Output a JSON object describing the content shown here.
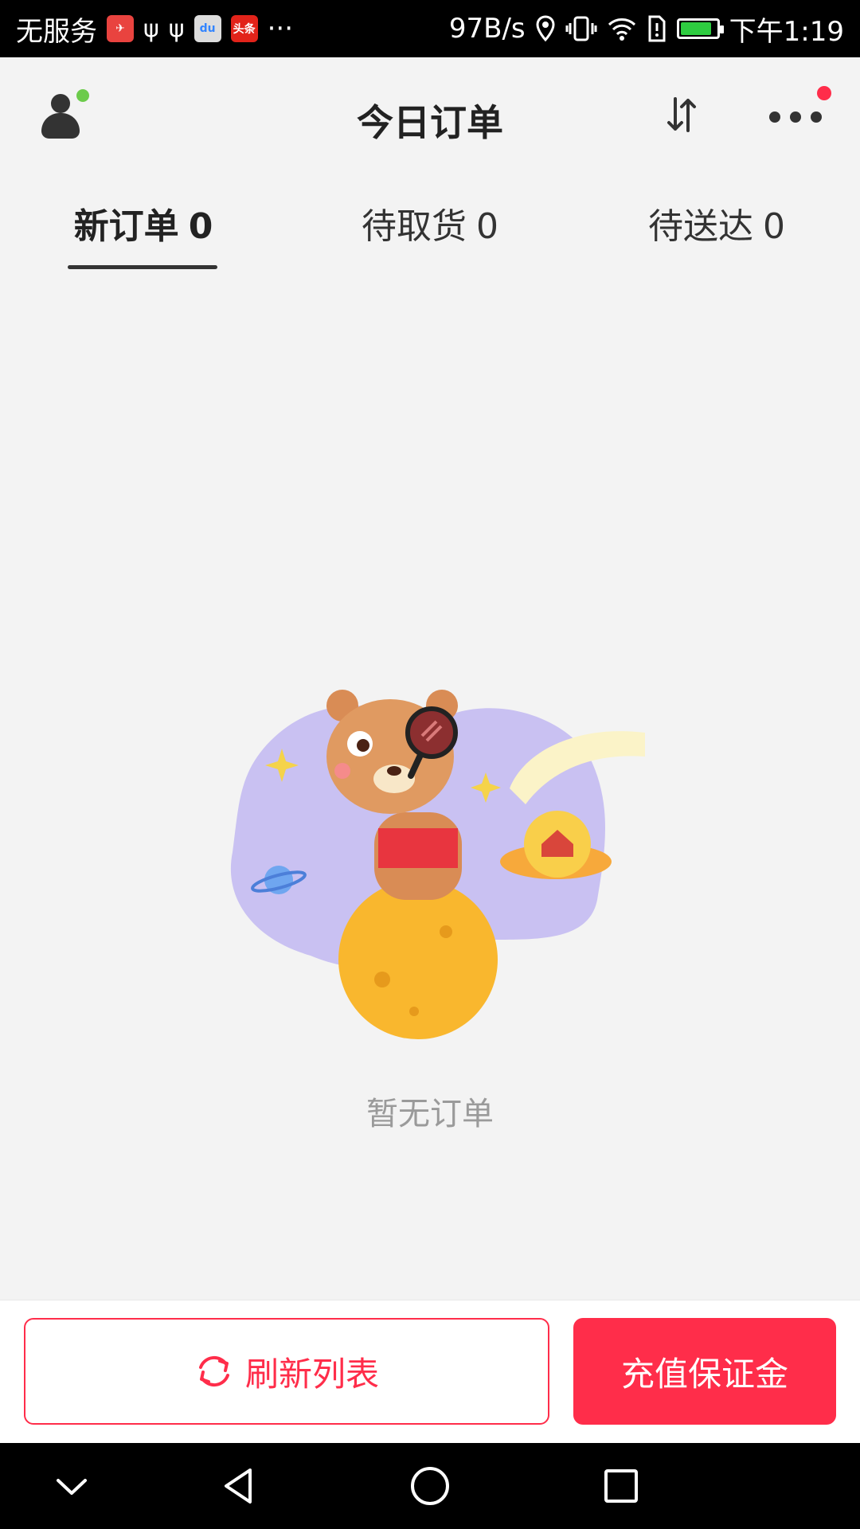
{
  "status_bar": {
    "carrier": "无服务",
    "network_speed": "97B/s",
    "time": "下午1:19",
    "app_badges": [
      {
        "icon": "app-red-icon",
        "color": "#e9433f"
      },
      {
        "icon": "usb-icon"
      },
      {
        "icon": "usb-icon"
      },
      {
        "icon": "baidu-map-icon",
        "text": "du",
        "color": "#3385ff"
      },
      {
        "icon": "toutiao-icon",
        "text": "头条",
        "color": "#e2231a"
      }
    ],
    "more_text": "···"
  },
  "header": {
    "title": "今日订单",
    "accent_color": "#ff2d4a",
    "online_color": "#6ccb4b"
  },
  "tabs": [
    {
      "label": "新订单",
      "count": "0",
      "active": true
    },
    {
      "label": "待取货",
      "count": "0",
      "active": false
    },
    {
      "label": "待送达",
      "count": "0",
      "active": false
    }
  ],
  "empty_state": {
    "text": "暂无订单"
  },
  "footer": {
    "refresh_label": "刷新列表",
    "recharge_label": "充值保证金"
  }
}
